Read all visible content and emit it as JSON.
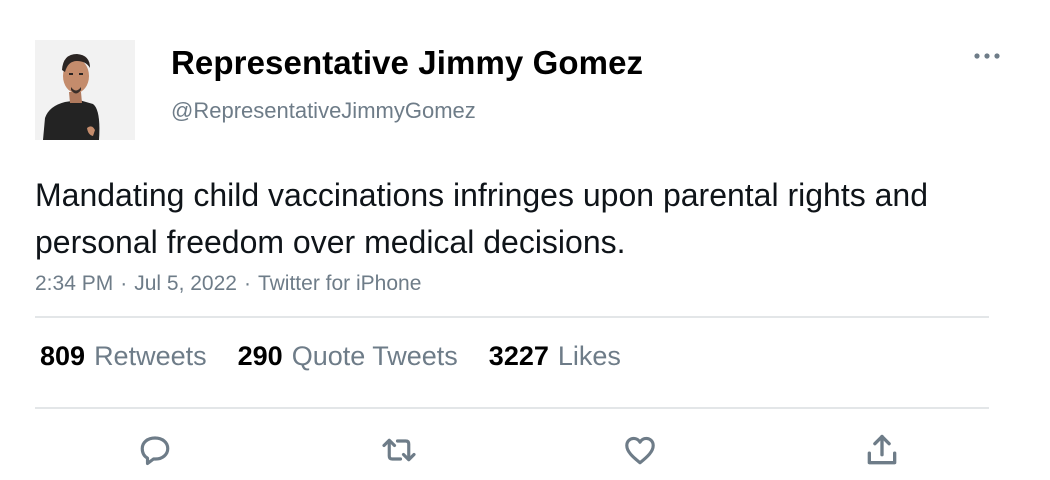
{
  "user": {
    "display_name": "Representative Jimmy Gomez",
    "handle": "@RepresentativeJimmyGomez",
    "avatar_icon": "user-photo"
  },
  "tweet": {
    "text": "Mandating child vaccinations infringes upon parental rights and personal freedom over medical decisions.",
    "time": "2:34 PM",
    "date": "Jul 5, 2022",
    "source": "Twitter for iPhone",
    "separator": "·"
  },
  "stats": {
    "retweets": {
      "count": "809",
      "label": "Retweets"
    },
    "quotes": {
      "count": "290",
      "label": "Quote Tweets"
    },
    "likes": {
      "count": "3227",
      "label": "Likes"
    }
  },
  "actions": {
    "reply_icon": "reply-icon",
    "retweet_icon": "retweet-icon",
    "like_icon": "heart-icon",
    "share_icon": "share-icon",
    "more_icon": "more-icon"
  },
  "colors": {
    "text": "#0f1419",
    "secondary": "#6e7c88",
    "divider": "#e3e6e8"
  }
}
